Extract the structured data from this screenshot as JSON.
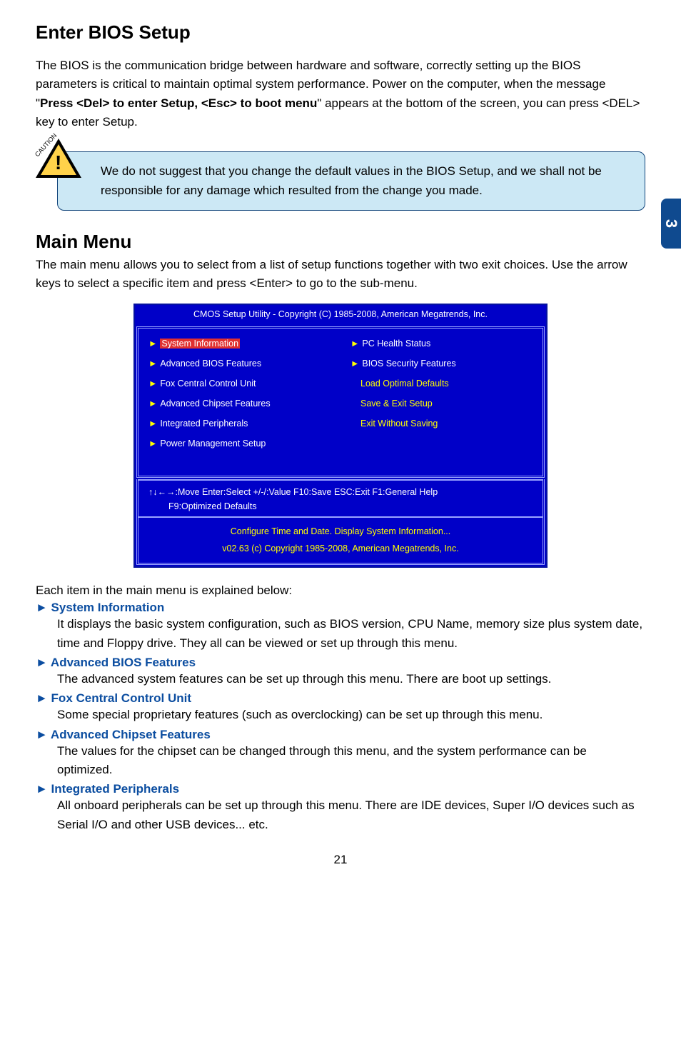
{
  "header": {
    "enter_bios": "Enter BIOS Setup"
  },
  "intro": {
    "p1a": "The BIOS is the communication bridge between hardware and software, correctly setting up the BIOS parameters is critical to maintain optimal system performance. Power on the computer, when the message \"",
    "p1b": "Press <Del> to enter Setup, <Esc> to boot menu",
    "p1c": "\" appears at the bottom of the screen, you can press <DEL> key to enter Setup."
  },
  "caution": {
    "label": "CAUTION",
    "bang": "!",
    "text": "We do not suggest that you change the default values in the BIOS Setup, and we shall not be responsible for any damage which resulted from the change you made."
  },
  "side_tab": "3",
  "mainmenu": {
    "title": "Main Menu",
    "p1": "The main menu allows you to select from a list of setup functions together with two exit choices. Use the arrow keys to select a specific item and press <Enter> to go to the sub-menu."
  },
  "bios": {
    "title": "CMOS Setup Utility - Copyright (C) 1985-2008, American Megatrends, Inc.",
    "left": [
      "System Information",
      "Advanced BIOS Features",
      "Fox Central Control Unit",
      "Advanced Chipset Features",
      "Integrated Peripherals",
      "Power Management Setup"
    ],
    "right": {
      "items": [
        "PC Health Status",
        "BIOS Security Features"
      ],
      "yellow": [
        "Load Optimal Defaults",
        "Save & Exit Setup",
        "Exit Without Saving"
      ]
    },
    "help1": "↑↓←→:Move  Enter:Select    +/-/:Value     F10:Save   ESC:Exit      F1:General Help",
    "help2": "F9:Optimized Defaults",
    "desc1": "Configure Time and Date.  Display System Information...",
    "desc2": "v02.63   (c) Copyright 1985-2008, American Megatrends, Inc."
  },
  "descriptions": {
    "intro": "Each item in the main menu is explained below:",
    "items": [
      {
        "head": "► System Information",
        "body": "It displays the basic system configuration, such as BIOS version, CPU Name, memory size plus system date, time and Floppy drive. They all can be viewed or set up through this menu."
      },
      {
        "head": "► Advanced BIOS Features",
        "body": "The advanced system features can be set up through this menu. There are boot up settings."
      },
      {
        "head": "► Fox Central Control Unit",
        "body": "Some special proprietary features (such as overclocking) can be set up through this menu."
      },
      {
        "head": "► Advanced Chipset Features",
        "body": "The values for the chipset can be changed through this menu, and the system performance can be optimized."
      },
      {
        "head": "► Integrated Peripherals",
        "body": "All onboard peripherals can be set up through this menu. There are IDE devices, Super I/O devices such as Serial I/O and other USB devices... etc."
      }
    ]
  },
  "page": "21"
}
